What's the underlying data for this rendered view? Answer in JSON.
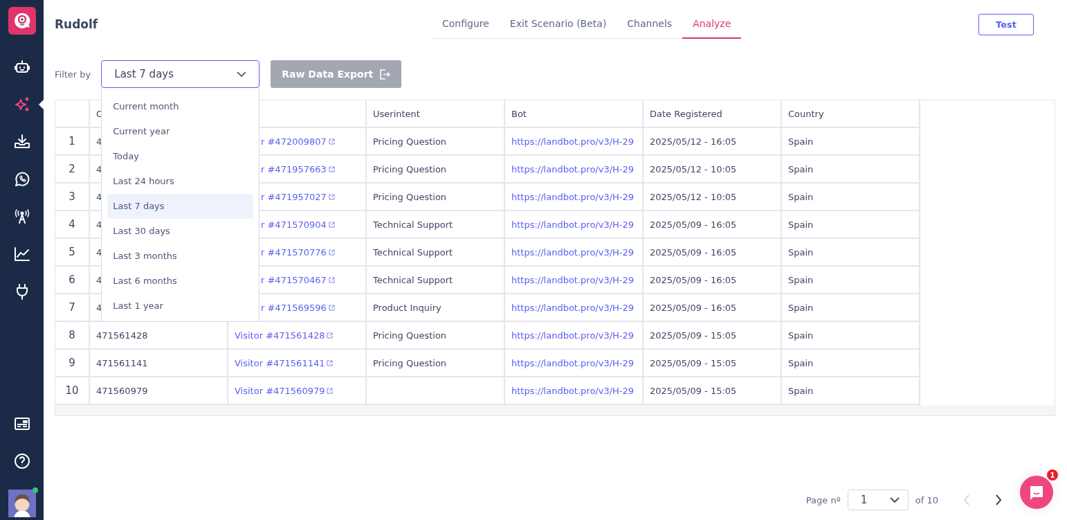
{
  "sidebar": {
    "items": [
      {
        "selected": false
      },
      {
        "selected": true
      },
      {
        "selected": false
      },
      {
        "selected": false
      },
      {
        "selected": false
      },
      {
        "selected": false
      },
      {
        "selected": false
      }
    ],
    "avatar": {
      "online": true
    }
  },
  "header": {
    "title": "Rudolf",
    "tabs": [
      {
        "label": "Configure",
        "selected": false
      },
      {
        "label": "Exit Scenario (Beta)",
        "selected": false
      },
      {
        "label": "Channels",
        "selected": false
      },
      {
        "label": "Analyze",
        "selected": true
      }
    ],
    "test_button": "Test"
  },
  "filter": {
    "label": "Filter by",
    "value": "Last 7 days",
    "expanded": true,
    "options": [
      {
        "label": "Current month",
        "selected": false
      },
      {
        "label": "Current year",
        "selected": false
      },
      {
        "label": "Today",
        "selected": false
      },
      {
        "label": "Last 24 hours",
        "selected": false
      },
      {
        "label": "Last 7 days",
        "selected": true
      },
      {
        "label": "Last 30 days",
        "selected": false
      },
      {
        "label": "Last 3 months",
        "selected": false
      },
      {
        "label": "Last 6 months",
        "selected": false
      },
      {
        "label": "Last 1 year",
        "selected": false
      }
    ],
    "export_button": {
      "label": "Raw Data Export",
      "disabled": true
    }
  },
  "table": {
    "columns": [
      {
        "label": "C"
      },
      {},
      {
        "label": "Userintent"
      },
      {
        "label": "Bot"
      },
      {
        "label": "Date Registered"
      },
      {
        "label": "Country"
      }
    ],
    "rows": [
      {
        "number": "1",
        "cells": [
          {
            "kind": "text",
            "text": "4"
          },
          {
            "kind": "visitor",
            "text": "r #472009807"
          },
          {
            "kind": "text",
            "text": "Pricing Question"
          },
          {
            "kind": "link",
            "text": "https://landbot.pro/v3/H-29"
          },
          {
            "kind": "text",
            "text": "2025/05/12 - 16:05"
          },
          {
            "kind": "text",
            "text": "Spain"
          }
        ]
      },
      {
        "number": "2",
        "cells": [
          {
            "kind": "text",
            "text": "4"
          },
          {
            "kind": "visitor",
            "text": "r #471957663"
          },
          {
            "kind": "text",
            "text": "Pricing Question"
          },
          {
            "kind": "link",
            "text": "https://landbot.pro/v3/H-29"
          },
          {
            "kind": "text",
            "text": "2025/05/12 - 10:05"
          },
          {
            "kind": "text",
            "text": "Spain"
          }
        ]
      },
      {
        "number": "3",
        "cells": [
          {
            "kind": "text",
            "text": "4"
          },
          {
            "kind": "visitor",
            "text": "r #471957027"
          },
          {
            "kind": "text",
            "text": "Pricing Question"
          },
          {
            "kind": "link",
            "text": "https://landbot.pro/v3/H-29"
          },
          {
            "kind": "text",
            "text": "2025/05/12 - 10:05"
          },
          {
            "kind": "text",
            "text": "Spain"
          }
        ]
      },
      {
        "number": "4",
        "cells": [
          {
            "kind": "text",
            "text": "4"
          },
          {
            "kind": "visitor",
            "text": "r #471570904"
          },
          {
            "kind": "text",
            "text": "Technical Support"
          },
          {
            "kind": "link",
            "text": "https://landbot.pro/v3/H-29"
          },
          {
            "kind": "text",
            "text": "2025/05/09 - 16:05"
          },
          {
            "kind": "text",
            "text": "Spain"
          }
        ]
      },
      {
        "number": "5",
        "cells": [
          {
            "kind": "text",
            "text": "4"
          },
          {
            "kind": "visitor",
            "text": "r #471570776"
          },
          {
            "kind": "text",
            "text": "Technical Support"
          },
          {
            "kind": "link",
            "text": "https://landbot.pro/v3/H-29"
          },
          {
            "kind": "text",
            "text": "2025/05/09 - 16:05"
          },
          {
            "kind": "text",
            "text": "Spain"
          }
        ]
      },
      {
        "number": "6",
        "cells": [
          {
            "kind": "text",
            "text": "4"
          },
          {
            "kind": "visitor",
            "text": "r #471570467"
          },
          {
            "kind": "text",
            "text": "Technical Support"
          },
          {
            "kind": "link",
            "text": "https://landbot.pro/v3/H-29"
          },
          {
            "kind": "text",
            "text": "2025/05/09 - 16:05"
          },
          {
            "kind": "text",
            "text": "Spain"
          }
        ]
      },
      {
        "number": "7",
        "cells": [
          {
            "kind": "text",
            "text": "4"
          },
          {
            "kind": "visitor",
            "text": "r #471569596"
          },
          {
            "kind": "text",
            "text": "Product Inquiry"
          },
          {
            "kind": "link",
            "text": "https://landbot.pro/v3/H-29"
          },
          {
            "kind": "text",
            "text": "2025/05/09 - 16:05"
          },
          {
            "kind": "text",
            "text": "Spain"
          }
        ]
      },
      {
        "number": "8",
        "cells": [
          {
            "kind": "text",
            "text": "471561428"
          },
          {
            "kind": "visitor",
            "text": "Visitor #471561428"
          },
          {
            "kind": "text",
            "text": "Pricing Question"
          },
          {
            "kind": "link",
            "text": "https://landbot.pro/v3/H-29"
          },
          {
            "kind": "text",
            "text": "2025/05/09 - 15:05"
          },
          {
            "kind": "text",
            "text": "Spain"
          }
        ]
      },
      {
        "number": "9",
        "cells": [
          {
            "kind": "text",
            "text": "471561141"
          },
          {
            "kind": "visitor",
            "text": "Visitor #471561141"
          },
          {
            "kind": "text",
            "text": "Pricing Question"
          },
          {
            "kind": "link",
            "text": "https://landbot.pro/v3/H-29"
          },
          {
            "kind": "text",
            "text": "2025/05/09 - 15:05"
          },
          {
            "kind": "text",
            "text": "Spain"
          }
        ]
      },
      {
        "number": "10",
        "cells": [
          {
            "kind": "text",
            "text": "471560979"
          },
          {
            "kind": "visitor",
            "text": "Visitor #471560979"
          },
          {
            "kind": "text"
          },
          {
            "kind": "link",
            "text": "https://landbot.pro/v3/H-29"
          },
          {
            "kind": "text",
            "text": "2025/05/09 - 15:05"
          },
          {
            "kind": "text",
            "text": "Spain"
          }
        ]
      }
    ]
  },
  "pagination": {
    "label": "Page nº",
    "page": "1",
    "total": "of 10",
    "prev_disabled": true,
    "next_disabled": false
  },
  "chat": {
    "badge": "1"
  }
}
